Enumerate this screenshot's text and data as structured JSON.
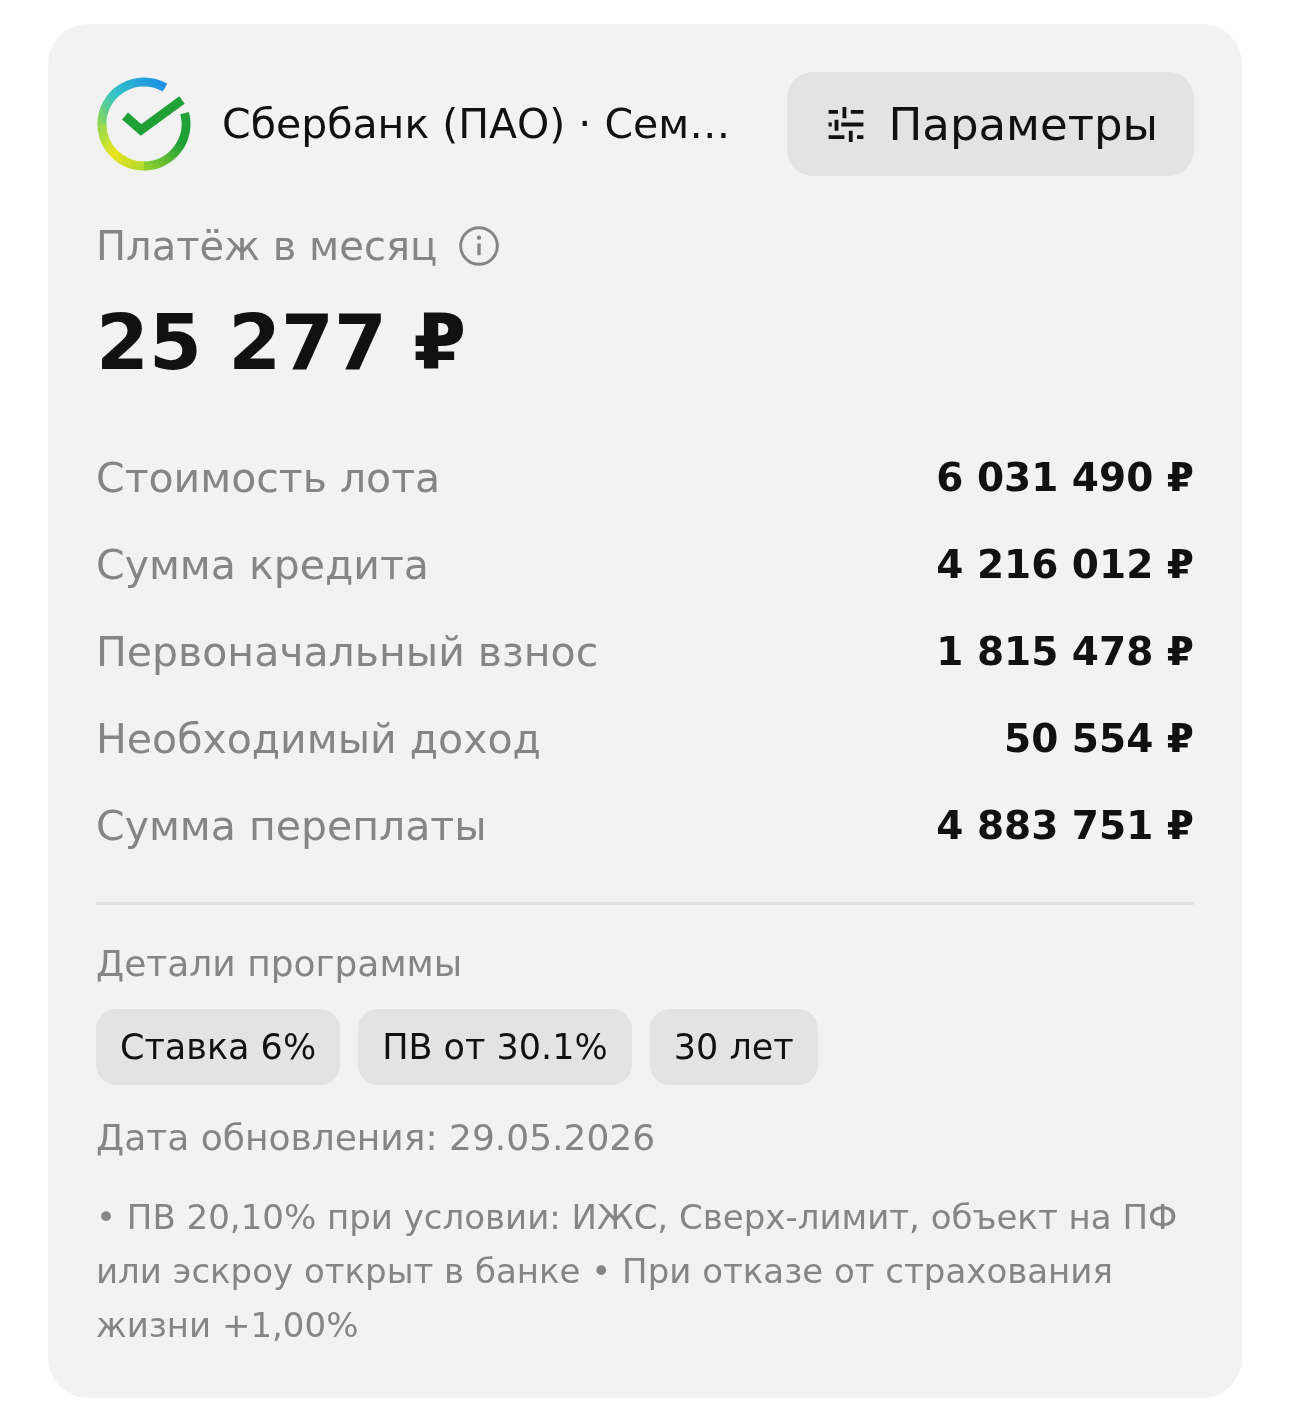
{
  "header": {
    "bank_name": "Сбербанк (ПАО) · Сем…",
    "parameters_button": "Параметры"
  },
  "payment": {
    "label": "Платёж в месяц",
    "amount": "25 277 ₽"
  },
  "details": [
    {
      "label": "Стоимость лота",
      "value": "6 031 490 ₽"
    },
    {
      "label": "Сумма кредита",
      "value": "4 216 012 ₽"
    },
    {
      "label": "Первоначальный взнос",
      "value": "1 815 478 ₽"
    },
    {
      "label": "Необходимый доход",
      "value": "50 554 ₽"
    },
    {
      "label": "Сумма переплаты",
      "value": "4 883 751 ₽"
    }
  ],
  "program": {
    "title": "Детали программы",
    "tags": [
      "Ставка 6%",
      "ПВ от 30.1%",
      "30 лет"
    ],
    "updated": "Дата обновления: 29.05.2026",
    "notes": "• ПВ 20,10% при условии: ИЖС, Сверх-лимит, объект на ПФ или эскроу открыт в банке • При отказе от страхования жизни +1,00%"
  }
}
